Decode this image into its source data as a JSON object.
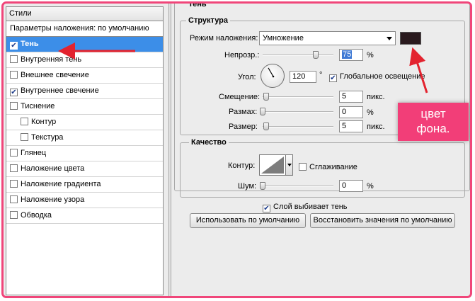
{
  "styles_panel": {
    "header": "Стили",
    "blending_options": "Параметры наложения: по умолчанию",
    "items": [
      {
        "label": "Тень",
        "checked": true,
        "selected": true,
        "sub": false
      },
      {
        "label": "Внутренняя тень",
        "checked": false,
        "selected": false,
        "sub": false
      },
      {
        "label": "Внешнее свечение",
        "checked": false,
        "selected": false,
        "sub": false
      },
      {
        "label": "Внутреннее свечение",
        "checked": true,
        "selected": false,
        "sub": false
      },
      {
        "label": "Тиснение",
        "checked": false,
        "selected": false,
        "sub": false
      },
      {
        "label": "Контур",
        "checked": false,
        "selected": false,
        "sub": true
      },
      {
        "label": "Текстура",
        "checked": false,
        "selected": false,
        "sub": true
      },
      {
        "label": "Глянец",
        "checked": false,
        "selected": false,
        "sub": false
      },
      {
        "label": "Наложение цвета",
        "checked": false,
        "selected": false,
        "sub": false
      },
      {
        "label": "Наложение градиента",
        "checked": false,
        "selected": false,
        "sub": false
      },
      {
        "label": "Наложение узора",
        "checked": false,
        "selected": false,
        "sub": false
      },
      {
        "label": "Обводка",
        "checked": false,
        "selected": false,
        "sub": false
      }
    ]
  },
  "settings": {
    "section_title": "Тень",
    "structure": {
      "title": "Структура",
      "blend_mode_label": "Режим наложения:",
      "blend_mode_value": "Умножение",
      "shadow_color": "#2a1a1e",
      "opacity_label": "Непрозр.:",
      "opacity_value": "75",
      "opacity_unit": "%",
      "opacity_level": 0.75,
      "angle_label": "Угол:",
      "angle_value": "120",
      "angle_unit": "°",
      "global_light_label": "Глобальное освещение",
      "global_light_checked": true,
      "distance_label": "Смещение:",
      "distance_value": "5",
      "distance_unit": "пикс.",
      "spread_label": "Размах:",
      "spread_value": "0",
      "spread_unit": "%",
      "size_label": "Размер:",
      "size_value": "5",
      "size_unit": "пикс."
    },
    "quality": {
      "title": "Качество",
      "contour_label": "Контур:",
      "antialias_label": "Сглаживание",
      "antialias_checked": false,
      "noise_label": "Шум:",
      "noise_value": "0",
      "noise_unit": "%"
    },
    "layer_knocks_out_label": "Слой выбивает тень",
    "layer_knocks_out_checked": true,
    "make_default_button": "Использовать по умолчанию",
    "reset_default_button": "Восстановить значения по умолчанию"
  },
  "annotation": {
    "line1": "цвет",
    "line2": "фона.",
    "color": "#f23e78"
  }
}
